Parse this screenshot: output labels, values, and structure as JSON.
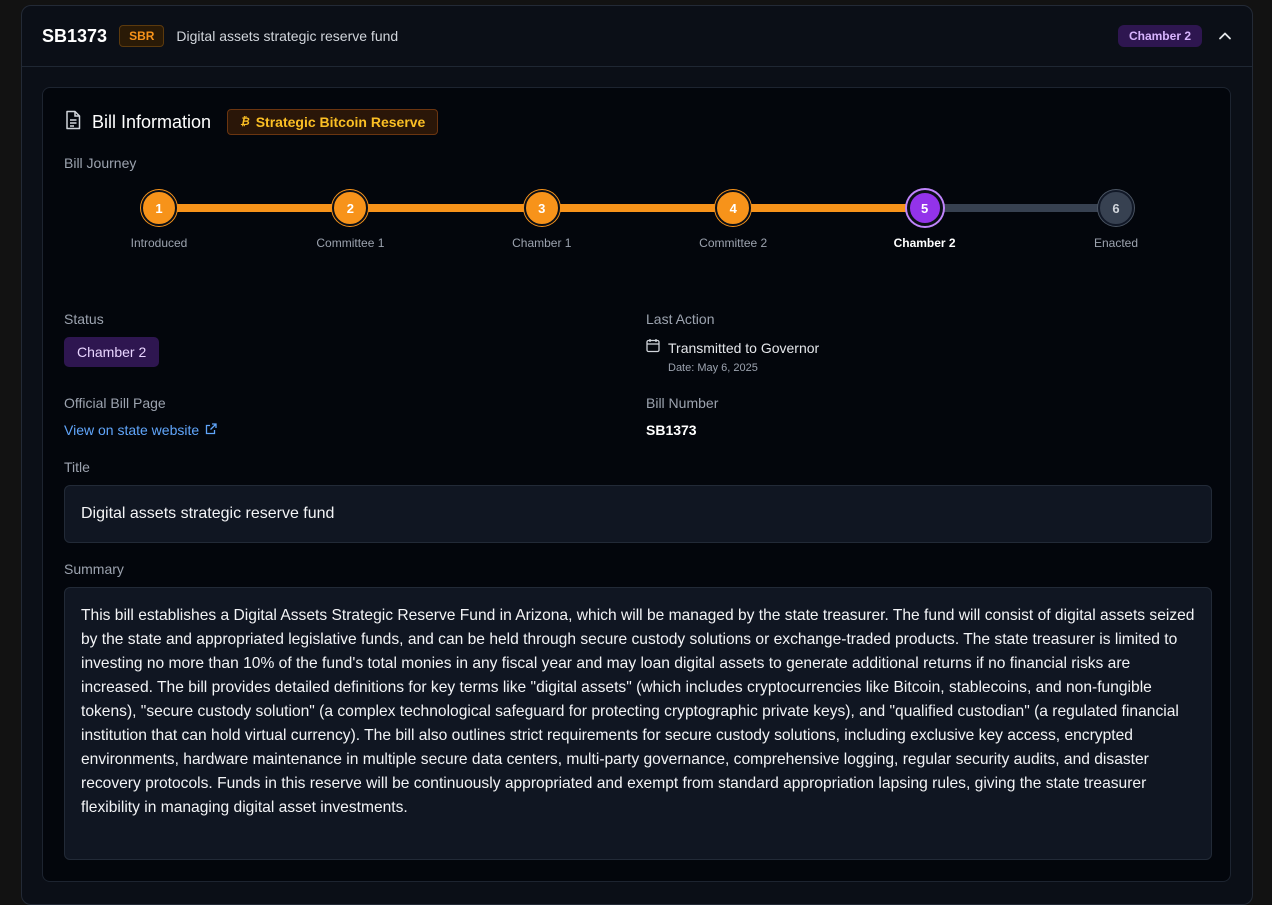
{
  "header": {
    "bill_id": "SB1373",
    "badge": "SBR",
    "title": "Digital assets strategic reserve fund",
    "chamber": "Chamber 2"
  },
  "info": {
    "heading": "Bill Information",
    "category_badge": "Strategic Bitcoin Reserve",
    "category_symbol": "₿"
  },
  "journey": {
    "label": "Bill Journey",
    "current_step": 5,
    "steps": [
      {
        "num": "1",
        "label": "Introduced"
      },
      {
        "num": "2",
        "label": "Committee 1"
      },
      {
        "num": "3",
        "label": "Chamber 1"
      },
      {
        "num": "4",
        "label": "Committee 2"
      },
      {
        "num": "5",
        "label": "Chamber 2"
      },
      {
        "num": "6",
        "label": "Enacted"
      }
    ]
  },
  "status": {
    "label": "Status",
    "value": "Chamber 2"
  },
  "last_action": {
    "label": "Last Action",
    "text": "Transmitted to Governor",
    "date": "Date: May 6, 2025"
  },
  "official": {
    "label": "Official Bill Page",
    "link_text": "View on state website"
  },
  "bill_number": {
    "label": "Bill Number",
    "value": "SB1373"
  },
  "title_section": {
    "label": "Title",
    "value": "Digital assets strategic reserve fund"
  },
  "summary_section": {
    "label": "Summary",
    "value": "This bill establishes a Digital Assets Strategic Reserve Fund in Arizona, which will be managed by the state treasurer. The fund will consist of digital assets seized by the state and appropriated legislative funds, and can be held through secure custody solutions or exchange-traded products. The state treasurer is limited to investing no more than 10% of the fund's total monies in any fiscal year and may loan digital assets to generate additional returns if no financial risks are increased. The bill provides detailed definitions for key terms like \"digital assets\" (which includes cryptocurrencies like Bitcoin, stablecoins, and non-fungible tokens), \"secure custody solution\" (a complex technological safeguard for protecting cryptographic private keys), and \"qualified custodian\" (a regulated financial institution that can hold virtual currency). The bill also outlines strict requirements for secure custody solutions, including exclusive key access, encrypted environments, hardware maintenance in multiple secure data centers, multi-party governance, comprehensive logging, regular security audits, and disaster recovery protocols. Funds in this reserve will be continuously appropriated and exempt from standard appropriation lapsing rules, giving the state treasurer flexibility in managing digital asset investments."
  },
  "colors": {
    "accent_orange": "#f7931a",
    "accent_purple": "#9333ea",
    "link_blue": "#60a5fa"
  }
}
